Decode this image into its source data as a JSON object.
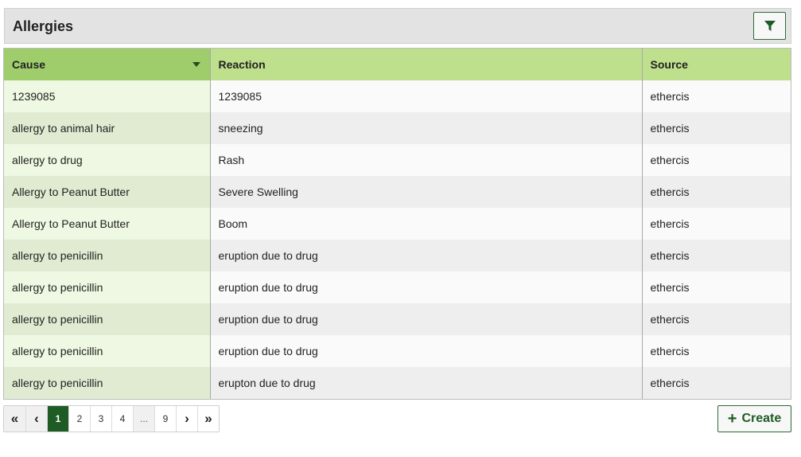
{
  "panel": {
    "title": "Allergies",
    "filter_icon": "filter-icon"
  },
  "table": {
    "columns": [
      {
        "label": "Cause",
        "sorted": "descending"
      },
      {
        "label": "Reaction"
      },
      {
        "label": "Source"
      }
    ],
    "rows": [
      {
        "cause": "1239085",
        "reaction": "1239085",
        "source": "ethercis"
      },
      {
        "cause": "allergy to animal hair",
        "reaction": "sneezing",
        "source": "ethercis"
      },
      {
        "cause": "allergy to drug",
        "reaction": "Rash",
        "source": "ethercis"
      },
      {
        "cause": "Allergy to Peanut Butter",
        "reaction": "Severe Swelling",
        "source": "ethercis"
      },
      {
        "cause": "Allergy to Peanut Butter",
        "reaction": "Boom",
        "source": "ethercis"
      },
      {
        "cause": "allergy to penicillin",
        "reaction": "eruption due to drug",
        "source": "ethercis"
      },
      {
        "cause": "allergy to penicillin",
        "reaction": "eruption due to drug",
        "source": "ethercis"
      },
      {
        "cause": "allergy to penicillin",
        "reaction": "eruption due to drug",
        "source": "ethercis"
      },
      {
        "cause": "allergy to penicillin",
        "reaction": "eruption due to drug",
        "source": "ethercis"
      },
      {
        "cause": "allergy to penicillin",
        "reaction": "erupton due to drug",
        "source": "ethercis"
      }
    ]
  },
  "pagination": {
    "first": "«",
    "prev": "‹",
    "next": "›",
    "last": "»",
    "pages": [
      "1",
      "2",
      "3",
      "4",
      "...",
      "9"
    ],
    "current": "1"
  },
  "actions": {
    "create_label": "Create",
    "create_icon": "plus-icon"
  },
  "colors": {
    "accent": "#1f5c25",
    "header_green": "#bedf8b",
    "sorted_header_green": "#9fcd6c"
  }
}
